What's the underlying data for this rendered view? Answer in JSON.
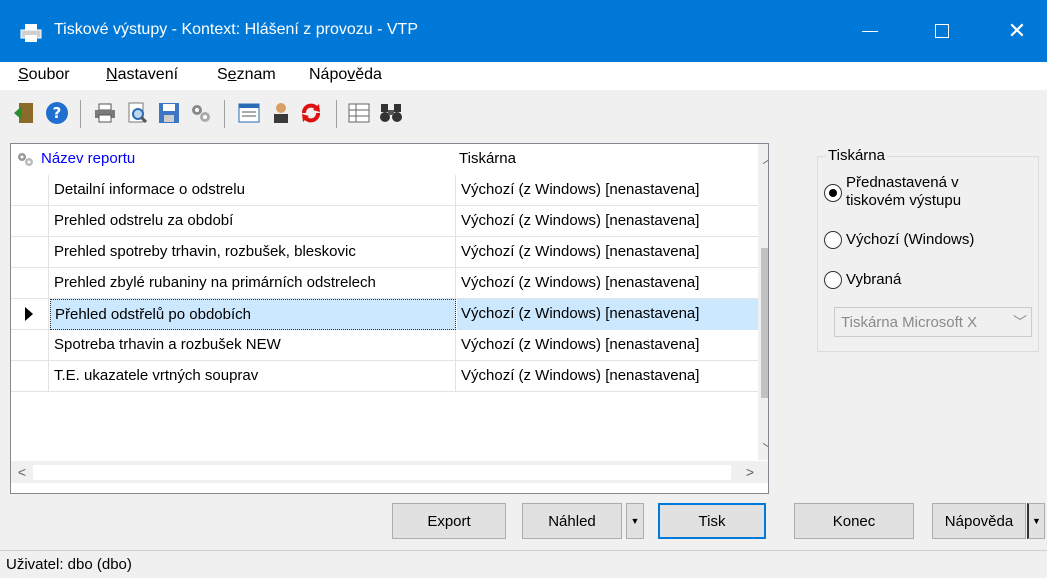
{
  "window": {
    "title": "Tiskové výstupy - Kontext: Hlášení z provozu - VTP",
    "buttons": {
      "minimize": "—",
      "maximize": "☐",
      "close": "✕"
    }
  },
  "menu": [
    {
      "label": "Soubor",
      "accel": "S",
      "rest": "oubor"
    },
    {
      "label": "Nastavení",
      "accel": "N",
      "rest": "astavení"
    },
    {
      "label": "Seznam",
      "pre": "S",
      "accel": "e",
      "rest": "znam"
    },
    {
      "label": "Nápověda",
      "pre": "Nápo",
      "accel": "v",
      "rest": "ěda"
    }
  ],
  "toolbar": {
    "icons": [
      "exit-icon",
      "help-icon",
      "print-icon",
      "preview-icon",
      "save-icon",
      "settings-icon",
      "list-icon",
      "user-icon",
      "refresh-icon",
      "table-icon",
      "binoculars-icon"
    ]
  },
  "grid": {
    "columns": {
      "name": "Název reportu",
      "printer": "Tiskárna"
    },
    "rows": [
      {
        "name": "Detailní informace o odstrelu",
        "printer": "Výchozí (z Windows)  [nenastavena]",
        "selected": false
      },
      {
        "name": "Prehled odstrelu za období",
        "printer": "Výchozí (z Windows)  [nenastavena]",
        "selected": false
      },
      {
        "name": "Prehled spotreby trhavin, rozbušek, bleskovic",
        "printer": "Výchozí (z Windows)  [nenastavena]",
        "selected": false
      },
      {
        "name": "Prehled zbylé rubaniny na primárních odstrelech",
        "printer": "Výchozí (z Windows)  [nenastavena]",
        "selected": false
      },
      {
        "name": "Přehled odstřelů po obdobích",
        "printer": "Výchozí (z Windows)  [nenastavena]",
        "selected": true
      },
      {
        "name": "Spotreba trhavin a rozbušek NEW",
        "printer": "Výchozí (z Windows)  [nenastavena]",
        "selected": false
      },
      {
        "name": "T.E. ukazatele vrtných souprav",
        "printer": "Výchozí (z Windows)  [nenastavena]",
        "selected": false
      }
    ]
  },
  "printer_group": {
    "legend": "Tiskárna",
    "options": [
      {
        "line1": "Přednastavená v",
        "line2": "tiskovém výstupu",
        "checked": true
      },
      {
        "line1": "Výchozí (Windows)",
        "line2": "",
        "checked": false
      },
      {
        "line1": "Vybraná",
        "line2": "",
        "checked": false
      }
    ],
    "combo_value": "Tiskárna Microsoft X",
    "combo_enabled": false
  },
  "buttons": {
    "export": "Export",
    "preview": "Náhled",
    "print": "Tisk",
    "close": "Konec",
    "help": "Nápověda"
  },
  "status": {
    "text": "Uživatel: dbo (dbo)"
  },
  "colors": {
    "titlebar": "#0078d7",
    "selection": "#cce8ff",
    "header_link": "#0000ff"
  }
}
